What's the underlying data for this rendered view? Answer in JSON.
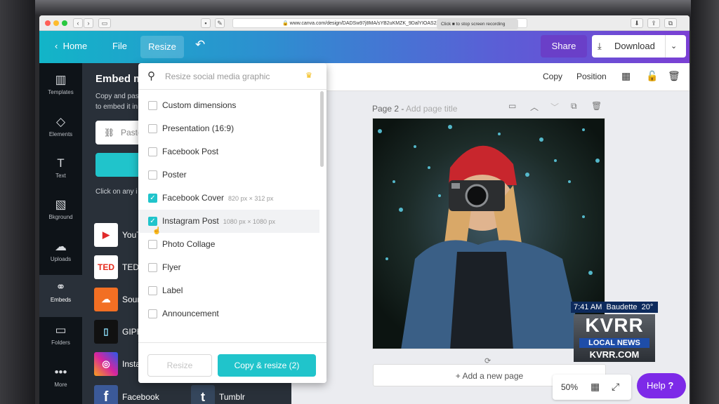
{
  "browser": {
    "url": "www.canva.com/design/DADSw97j8MA/sYB2uKMZK_9DalYIOAS2A",
    "recording_tip": "Click ■ to stop screen recording"
  },
  "topbar": {
    "home": "Home",
    "file": "File",
    "resize": "Resize",
    "share": "Share",
    "download": "Download"
  },
  "rail": [
    {
      "label": "Templates",
      "icon": "▥"
    },
    {
      "label": "Elements",
      "icon": "◇"
    },
    {
      "label": "Text",
      "icon": "T"
    },
    {
      "label": "Bkground",
      "icon": "▧"
    },
    {
      "label": "Uploads",
      "icon": "☁"
    },
    {
      "label": "Embeds",
      "icon": "⚭"
    },
    {
      "label": "Folders",
      "icon": "▭"
    },
    {
      "label": "More",
      "icon": "•••"
    }
  ],
  "panel": {
    "title": "Embed m",
    "desc_line1": "Copy and pas",
    "desc_line2": "to embed it in",
    "paste_placeholder": "Paste",
    "hint": "Click on any i",
    "embeds": [
      {
        "label": "YouT",
        "logo": "▶",
        "color": "#ffffff"
      },
      {
        "label": "TED",
        "logo": "TED",
        "color": "#ffffff"
      },
      {
        "label": "Sour",
        "logo": "☁",
        "color": "#f26f23"
      },
      {
        "label": "GIPH",
        "logo": "▯",
        "color": "#111111"
      },
      {
        "label": "Insta",
        "logo": "◎",
        "color": "#c13584"
      },
      {
        "label": "Facebook",
        "logo": "f",
        "color": "#3b5998"
      }
    ],
    "embed_tumblr": {
      "label": "Tumblr",
      "logo": "t",
      "color": "#35465c"
    }
  },
  "dropdown": {
    "search_placeholder": "Resize social media graphic",
    "items": [
      {
        "label": "Custom dimensions",
        "size": "",
        "checked": false
      },
      {
        "label": "Presentation (16:9)",
        "size": "",
        "checked": false
      },
      {
        "label": "Facebook Post",
        "size": "",
        "checked": false
      },
      {
        "label": "Poster",
        "size": "",
        "checked": false
      },
      {
        "label": "Facebook Cover",
        "size": "820 px × 312 px",
        "checked": true
      },
      {
        "label": "Instagram Post",
        "size": "1080 px × 1080 px",
        "checked": true
      },
      {
        "label": "Photo Collage",
        "size": "",
        "checked": false
      },
      {
        "label": "Flyer",
        "size": "",
        "checked": false
      },
      {
        "label": "Label",
        "size": "",
        "checked": false
      },
      {
        "label": "Announcement",
        "size": "",
        "checked": false
      }
    ],
    "resize_btn": "Resize",
    "copy_resize_btn": "Copy & resize (2)"
  },
  "editbar": {
    "copy": "Copy",
    "position": "Position"
  },
  "page": {
    "label": "Page 2 -",
    "title_placeholder": "Add page title",
    "add_page": "+ Add a new page"
  },
  "zoom": "50%",
  "help": "Help",
  "news": {
    "time": "7:41 AM",
    "location": "Baudette",
    "temp": "20°",
    "logo": "KVRR",
    "sub": "LOCAL NEWS",
    "site": "KVRR.COM"
  }
}
